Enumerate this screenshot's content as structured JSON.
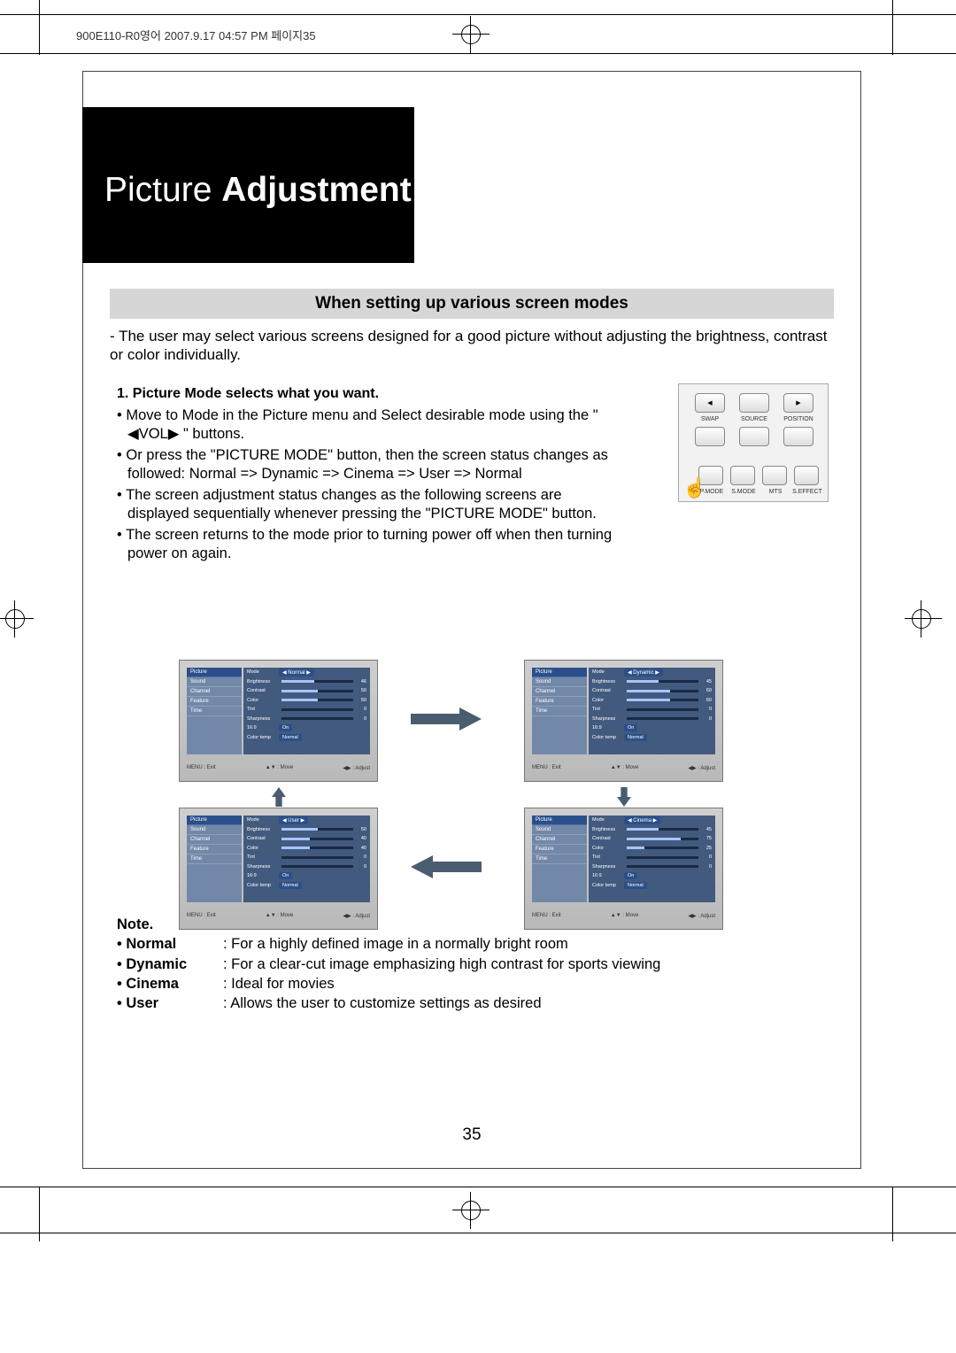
{
  "slug": "900E110-R0영어  2007.9.17 04:57 PM 페이지35",
  "title_plain": "Picture ",
  "title_bold": "Adjustment",
  "heading": "When setting up various screen modes",
  "intro": "- The user may select various screens designed for a good picture without adjusting the brightness, contrast or color individually.",
  "step_head": "1. Picture Mode selects what you want.",
  "bullets": [
    "• Move to Mode in the Picture menu and Select desirable mode using the \" ◀VOL▶ \" buttons.",
    "• Or press the \"PICTURE MODE\" button, then the screen status changes as followed: Normal => Dynamic => Cinema => User  => Normal",
    "• The screen adjustment status changes as the following screens are displayed sequentially whenever pressing the \"PICTURE MODE\" button.",
    "• The screen returns to the mode prior to turning power off when then turning power on again."
  ],
  "remote": {
    "top": [
      "◀",
      "",
      "▶"
    ],
    "caps_top": [
      "SWAP",
      "SOURCE",
      "POSITION"
    ],
    "caps_bot": [
      "P.MODE",
      "S.MODE",
      "MTS",
      "S.EFFECT"
    ]
  },
  "osd_side": [
    "Picture",
    "Sound",
    "Channel",
    "Feature",
    "Time"
  ],
  "osd_foot": [
    "MENU : Exit",
    "▲▼ : Move",
    "◀▶ : Adjust"
  ],
  "chart_data": [
    {
      "type": "table",
      "title": "Mode: Normal",
      "rows": [
        {
          "label": "Brightness",
          "value": 46
        },
        {
          "label": "Contrast",
          "value": 50
        },
        {
          "label": "Color",
          "value": 50
        },
        {
          "label": "Tint",
          "value": 0
        },
        {
          "label": "Sharpness",
          "value": 0
        },
        {
          "label": "16:9",
          "value": "On"
        },
        {
          "label": "Color temp",
          "value": "Normal"
        }
      ]
    },
    {
      "type": "table",
      "title": "Mode: Dynamic",
      "rows": [
        {
          "label": "Brightness",
          "value": 45
        },
        {
          "label": "Contrast",
          "value": 60
        },
        {
          "label": "Color",
          "value": 60
        },
        {
          "label": "Tint",
          "value": 0
        },
        {
          "label": "Sharpness",
          "value": 0
        },
        {
          "label": "16:9",
          "value": "On"
        },
        {
          "label": "Color temp",
          "value": "Normal"
        }
      ]
    },
    {
      "type": "table",
      "title": "Mode: Cinema",
      "rows": [
        {
          "label": "Brightness",
          "value": 45
        },
        {
          "label": "Contrast",
          "value": 75
        },
        {
          "label": "Color",
          "value": 25
        },
        {
          "label": "Tint",
          "value": 0
        },
        {
          "label": "Sharpness",
          "value": 0
        },
        {
          "label": "16:9",
          "value": "On"
        },
        {
          "label": "Color temp",
          "value": "Normal"
        }
      ]
    },
    {
      "type": "table",
      "title": "Mode: User",
      "rows": [
        {
          "label": "Brightness",
          "value": 50
        },
        {
          "label": "Contrast",
          "value": 40
        },
        {
          "label": "Color",
          "value": 40
        },
        {
          "label": "Tint",
          "value": 0
        },
        {
          "label": "Sharpness",
          "value": 0
        },
        {
          "label": "16:9",
          "value": "On"
        },
        {
          "label": "Color temp",
          "value": "Normal"
        }
      ]
    }
  ],
  "note": {
    "head": "Note.",
    "rows": [
      {
        "k": "• Normal",
        "v": ": For a highly defined image in a normally bright room"
      },
      {
        "k": "• Dynamic",
        "v": ": For a clear-cut image emphasizing high contrast for sports viewing"
      },
      {
        "k": "• Cinema",
        "v": ": Ideal for movies"
      },
      {
        "k": "• User",
        "v": ": Allows the user to customize settings as desired"
      }
    ]
  },
  "page_number": "35"
}
